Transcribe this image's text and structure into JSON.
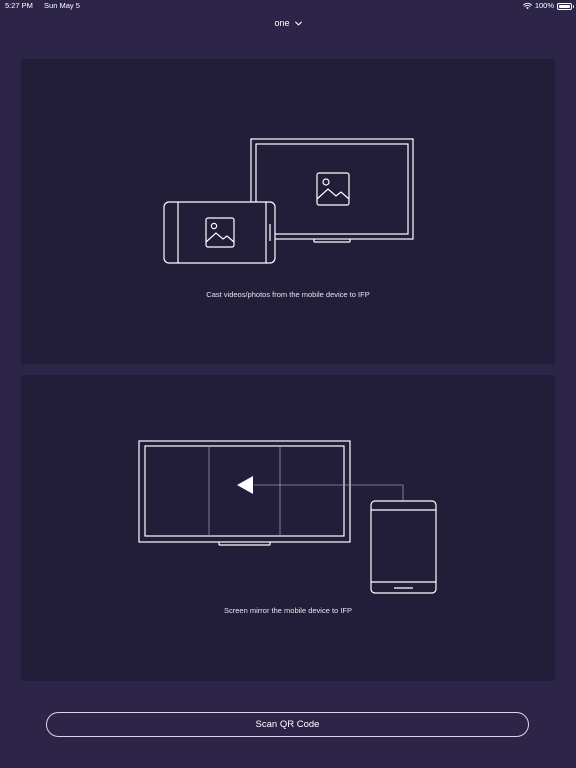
{
  "status_bar": {
    "time": "5:27 PM",
    "date": "Sun May 5",
    "battery": "100%",
    "wifi_icon": "wifi-icon",
    "battery_icon": "battery-icon"
  },
  "header": {
    "title": "one",
    "dropdown_icon": "chevron-down-icon"
  },
  "cards": [
    {
      "label": "Cast videos/photos from the mobile device to IFP",
      "illustration": "cast-media-illustration"
    },
    {
      "label": "Screen mirror the mobile device to IFP",
      "illustration": "screen-mirror-illustration"
    }
  ],
  "actions": {
    "scan_label": "Scan QR Code"
  },
  "colors": {
    "background": "#2d2548",
    "card": "#221d39",
    "line": "#ffffff"
  }
}
